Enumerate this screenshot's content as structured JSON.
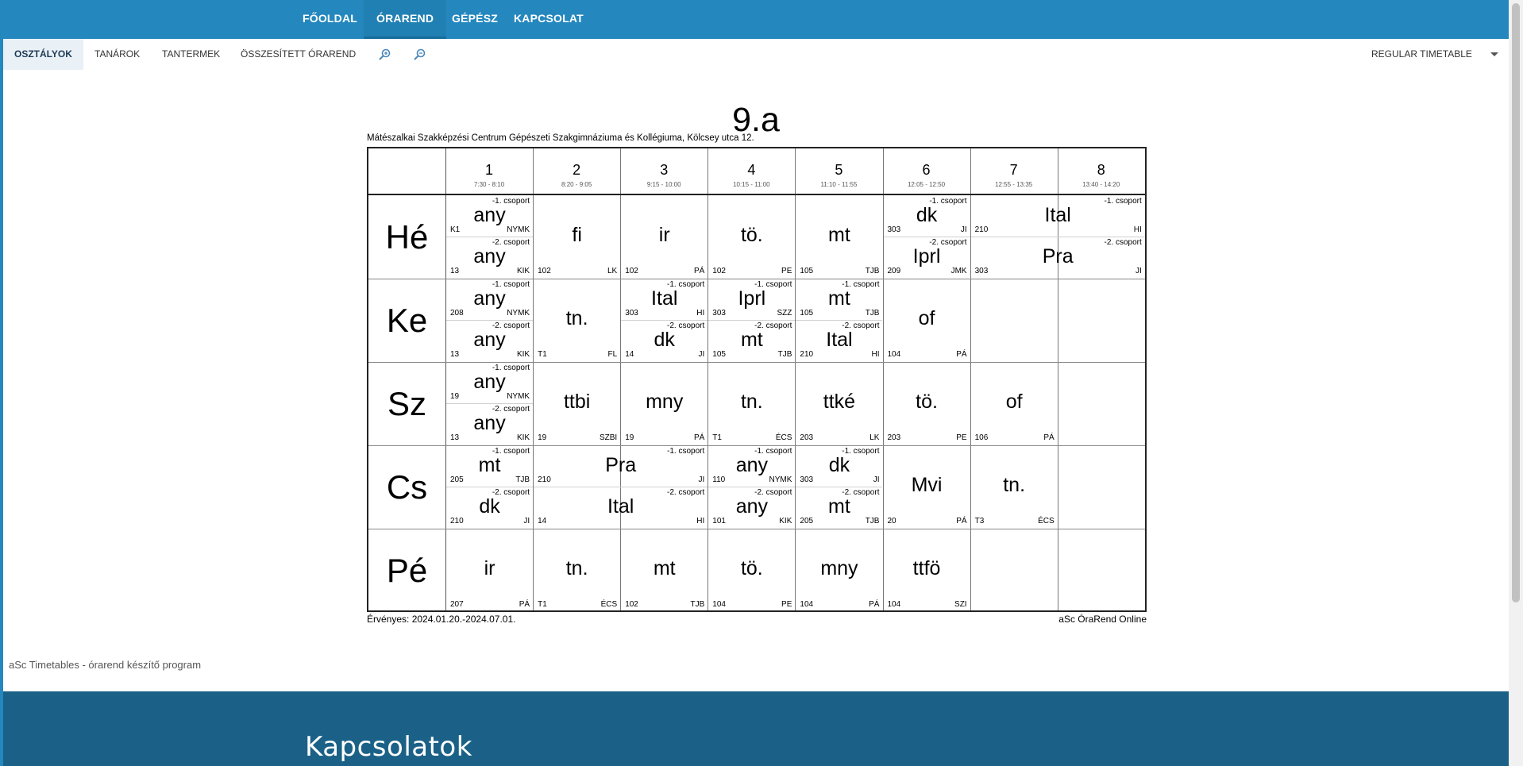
{
  "nav": {
    "items": [
      "FŐOLDAL",
      "ÓRAREND",
      "GÉPÉSZ",
      "KAPCSOLAT"
    ],
    "active": "ÓRAREND"
  },
  "subnav": {
    "tabs": [
      "OSZTÁLYOK",
      "TANÁROK",
      "TANTERMEK",
      "ÖSSZESÍTETT ÓRAREND"
    ],
    "active": "OSZTÁLYOK",
    "timetable_select": "REGULAR TIMETABLE"
  },
  "timetable": {
    "title": "9.a",
    "school": "Mátészalkai Szakképzési Centrum Gépészeti Szakgimnáziuma és Kollégiuma, Kölcsey utca 12.",
    "periods": [
      {
        "num": "1",
        "time": "7:30 - 8:10"
      },
      {
        "num": "2",
        "time": "8:20 - 9:05"
      },
      {
        "num": "3",
        "time": "9:15 - 10:00"
      },
      {
        "num": "4",
        "time": "10:15 - 11:00"
      },
      {
        "num": "5",
        "time": "11:10 - 11:55"
      },
      {
        "num": "6",
        "time": "12:05 - 12:50"
      },
      {
        "num": "7",
        "time": "12:55 - 13:35"
      },
      {
        "num": "8",
        "time": "13:40 - 14:20"
      }
    ],
    "days": [
      {
        "name": "Hé",
        "lessons": [
          {
            "p": 1,
            "span": 1,
            "top": {
              "subj": "any",
              "room": "K1",
              "teacher": "NYMK",
              "group": "-1. csoport"
            },
            "bottom": {
              "subj": "any",
              "room": "13",
              "teacher": "KIK",
              "group": "-2. csoport"
            }
          },
          {
            "p": 2,
            "span": 1,
            "full": {
              "subj": "fi",
              "room": "102",
              "teacher": "LK"
            }
          },
          {
            "p": 3,
            "span": 1,
            "full": {
              "subj": "ir",
              "room": "102",
              "teacher": "PÁ"
            }
          },
          {
            "p": 4,
            "span": 1,
            "full": {
              "subj": "tö.",
              "room": "102",
              "teacher": "PE"
            }
          },
          {
            "p": 5,
            "span": 1,
            "full": {
              "subj": "mt",
              "room": "105",
              "teacher": "TJB"
            }
          },
          {
            "p": 6,
            "span": 1,
            "top": {
              "subj": "dk",
              "room": "303",
              "teacher": "JI",
              "group": "-1. csoport"
            },
            "bottom": {
              "subj": "Iprl",
              "room": "209",
              "teacher": "JMK",
              "group": "-2. csoport"
            }
          },
          {
            "p": 7,
            "span": 2,
            "top": {
              "subj": "Ital",
              "room": "210",
              "teacher": "HI",
              "group": "-1. csoport"
            },
            "bottom": {
              "subj": "Pra",
              "room": "303",
              "teacher": "JI",
              "group": "-2. csoport"
            }
          }
        ]
      },
      {
        "name": "Ke",
        "lessons": [
          {
            "p": 1,
            "span": 1,
            "top": {
              "subj": "any",
              "room": "208",
              "teacher": "NYMK",
              "group": "-1. csoport"
            },
            "bottom": {
              "subj": "any",
              "room": "13",
              "teacher": "KIK",
              "group": "-2. csoport"
            }
          },
          {
            "p": 2,
            "span": 1,
            "full": {
              "subj": "tn.",
              "room": "T1",
              "teacher": "FL"
            }
          },
          {
            "p": 3,
            "span": 1,
            "top": {
              "subj": "Ital",
              "room": "303",
              "teacher": "HI",
              "group": "-1. csoport"
            },
            "bottom": {
              "subj": "dk",
              "room": "14",
              "teacher": "JI",
              "group": "-2. csoport"
            }
          },
          {
            "p": 4,
            "span": 1,
            "top": {
              "subj": "Iprl",
              "room": "303",
              "teacher": "SZZ",
              "group": "-1. csoport"
            },
            "bottom": {
              "subj": "mt",
              "room": "105",
              "teacher": "TJB",
              "group": "-2. csoport"
            }
          },
          {
            "p": 5,
            "span": 1,
            "top": {
              "subj": "mt",
              "room": "105",
              "teacher": "TJB",
              "group": "-1. csoport"
            },
            "bottom": {
              "subj": "Ital",
              "room": "210",
              "teacher": "HI",
              "group": "-2. csoport"
            }
          },
          {
            "p": 6,
            "span": 1,
            "full": {
              "subj": "of",
              "room": "104",
              "teacher": "PÁ"
            }
          }
        ]
      },
      {
        "name": "Sz",
        "lessons": [
          {
            "p": 1,
            "span": 1,
            "top": {
              "subj": "any",
              "room": "19",
              "teacher": "NYMK",
              "group": "-1. csoport"
            },
            "bottom": {
              "subj": "any",
              "room": "13",
              "teacher": "KIK",
              "group": "-2. csoport"
            }
          },
          {
            "p": 2,
            "span": 1,
            "full": {
              "subj": "ttbi",
              "room": "19",
              "teacher": "SZBI"
            }
          },
          {
            "p": 3,
            "span": 1,
            "full": {
              "subj": "mny",
              "room": "19",
              "teacher": "PÁ"
            }
          },
          {
            "p": 4,
            "span": 1,
            "full": {
              "subj": "tn.",
              "room": "T1",
              "teacher": "ÉCS"
            }
          },
          {
            "p": 5,
            "span": 1,
            "full": {
              "subj": "ttké",
              "room": "203",
              "teacher": "LK"
            }
          },
          {
            "p": 6,
            "span": 1,
            "full": {
              "subj": "tö.",
              "room": "203",
              "teacher": "PE"
            }
          },
          {
            "p": 7,
            "span": 1,
            "full": {
              "subj": "of",
              "room": "106",
              "teacher": "PÁ"
            }
          }
        ]
      },
      {
        "name": "Cs",
        "lessons": [
          {
            "p": 1,
            "span": 1,
            "top": {
              "subj": "mt",
              "room": "205",
              "teacher": "TJB",
              "group": "-1. csoport"
            },
            "bottom": {
              "subj": "dk",
              "room": "210",
              "teacher": "JI",
              "group": "-2. csoport"
            }
          },
          {
            "p": 2,
            "span": 2,
            "top": {
              "subj": "Pra",
              "room": "210",
              "teacher": "JI",
              "group": "-1. csoport"
            },
            "bottom": {
              "subj": "Ital",
              "room": "14",
              "teacher": "HI",
              "group": "-2. csoport"
            }
          },
          {
            "p": 4,
            "span": 1,
            "top": {
              "subj": "any",
              "room": "110",
              "teacher": "NYMK",
              "group": "-1. csoport"
            },
            "bottom": {
              "subj": "any",
              "room": "101",
              "teacher": "KIK",
              "group": "-2. csoport"
            }
          },
          {
            "p": 5,
            "span": 1,
            "top": {
              "subj": "dk",
              "room": "303",
              "teacher": "JI",
              "group": "-1. csoport"
            },
            "bottom": {
              "subj": "mt",
              "room": "205",
              "teacher": "TJB",
              "group": "-2. csoport"
            }
          },
          {
            "p": 6,
            "span": 1,
            "full": {
              "subj": "Mvi",
              "room": "20",
              "teacher": "PÁ"
            }
          },
          {
            "p": 7,
            "span": 1,
            "full": {
              "subj": "tn.",
              "room": "T3",
              "teacher": "ÉCS"
            }
          }
        ]
      },
      {
        "name": "Pé",
        "lessons": [
          {
            "p": 1,
            "span": 1,
            "full": {
              "subj": "ir",
              "room": "207",
              "teacher": "PÁ"
            }
          },
          {
            "p": 2,
            "span": 1,
            "full": {
              "subj": "tn.",
              "room": "T1",
              "teacher": "ÉCS"
            }
          },
          {
            "p": 3,
            "span": 1,
            "full": {
              "subj": "mt",
              "room": "102",
              "teacher": "TJB"
            }
          },
          {
            "p": 4,
            "span": 1,
            "full": {
              "subj": "tö.",
              "room": "104",
              "teacher": "PE"
            }
          },
          {
            "p": 5,
            "span": 1,
            "full": {
              "subj": "mny",
              "room": "104",
              "teacher": "PÁ"
            }
          },
          {
            "p": 6,
            "span": 1,
            "full": {
              "subj": "ttfö",
              "room": "104",
              "teacher": "SZI"
            }
          }
        ]
      }
    ],
    "valid": "Érvényes: 2024.01.20.-2024.07.01.",
    "credit": "aSc ÓraRend Online"
  },
  "note": "aSc Timetables - órarend készítő program",
  "footer": {
    "heading": "Kapcsolatok"
  },
  "colors": {
    "brand": "#2487be",
    "footer": "#1b6187",
    "active_tab_bg": "#e9f1f7"
  },
  "icons": [
    "zoom-in-icon",
    "zoom-out-icon",
    "chevron-down-icon"
  ]
}
